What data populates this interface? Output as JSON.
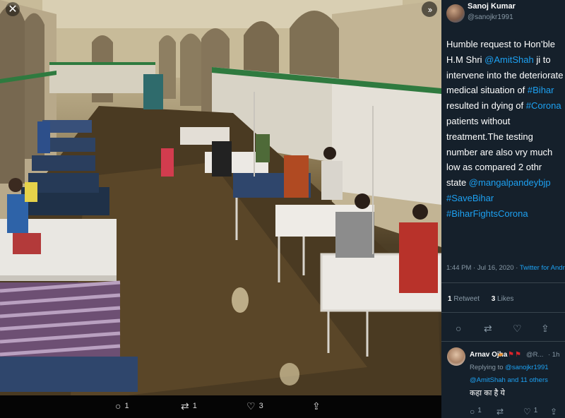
{
  "media": {
    "close_icon": "close-icon",
    "toggle_icon": "chevron-double-right-icon",
    "actions": {
      "reply": {
        "icon": "comment-icon",
        "count": "1"
      },
      "retweet": {
        "icon": "retweet-icon",
        "count": "1"
      },
      "like": {
        "icon": "heart-icon",
        "count": "3"
      },
      "share": {
        "icon": "share-icon"
      }
    }
  },
  "tweet": {
    "author": {
      "name": "Sanoj Kumar",
      "handle": "@sanojkr1991"
    },
    "text_parts": [
      {
        "t": "Humble request to Hon’ble H.M Shri ",
        "link": false
      },
      {
        "t": "@AmitShah",
        "link": true
      },
      {
        "t": " ji to intervene into the deteriorate medical situation of ",
        "link": false
      },
      {
        "t": "#Bihar",
        "link": true
      },
      {
        "t": " resulted in dying of ",
        "link": false
      },
      {
        "t": "#Corona",
        "link": true
      },
      {
        "t": " patients without treatment.The testing number are also vry much low as compared 2 othr state ",
        "link": false
      },
      {
        "t": "@mangalpandeybjp",
        "link": true
      },
      {
        "t": "\n",
        "link": false
      },
      {
        "t": "#SaveBihar",
        "link": true
      },
      {
        "t": "\n",
        "link": false
      },
      {
        "t": "#BiharFightsCorona",
        "link": true
      }
    ],
    "time": "1:44 PM · Jul 16, 2020 · ",
    "source": "Twitter for Android",
    "retweets": "1",
    "retweets_label": "Retweet",
    "likes": "3",
    "likes_label": "Likes"
  },
  "reply": {
    "name": "Arnav Ojha",
    "handle": "@R...",
    "time": "· 1h",
    "replying_prefix": "Replying to ",
    "replying_user": "@sanojkr1991",
    "replying_line2_user": "@AmitShah",
    "replying_line2_rest": " and 11 others",
    "text": "कहा का है ये",
    "actions": {
      "reply": "1",
      "retweet": "",
      "like": "1"
    }
  },
  "colors": {
    "panel_bg": "#15202b",
    "link": "#1da1f2",
    "muted": "#8899a6",
    "bar_bg": "#050505"
  }
}
